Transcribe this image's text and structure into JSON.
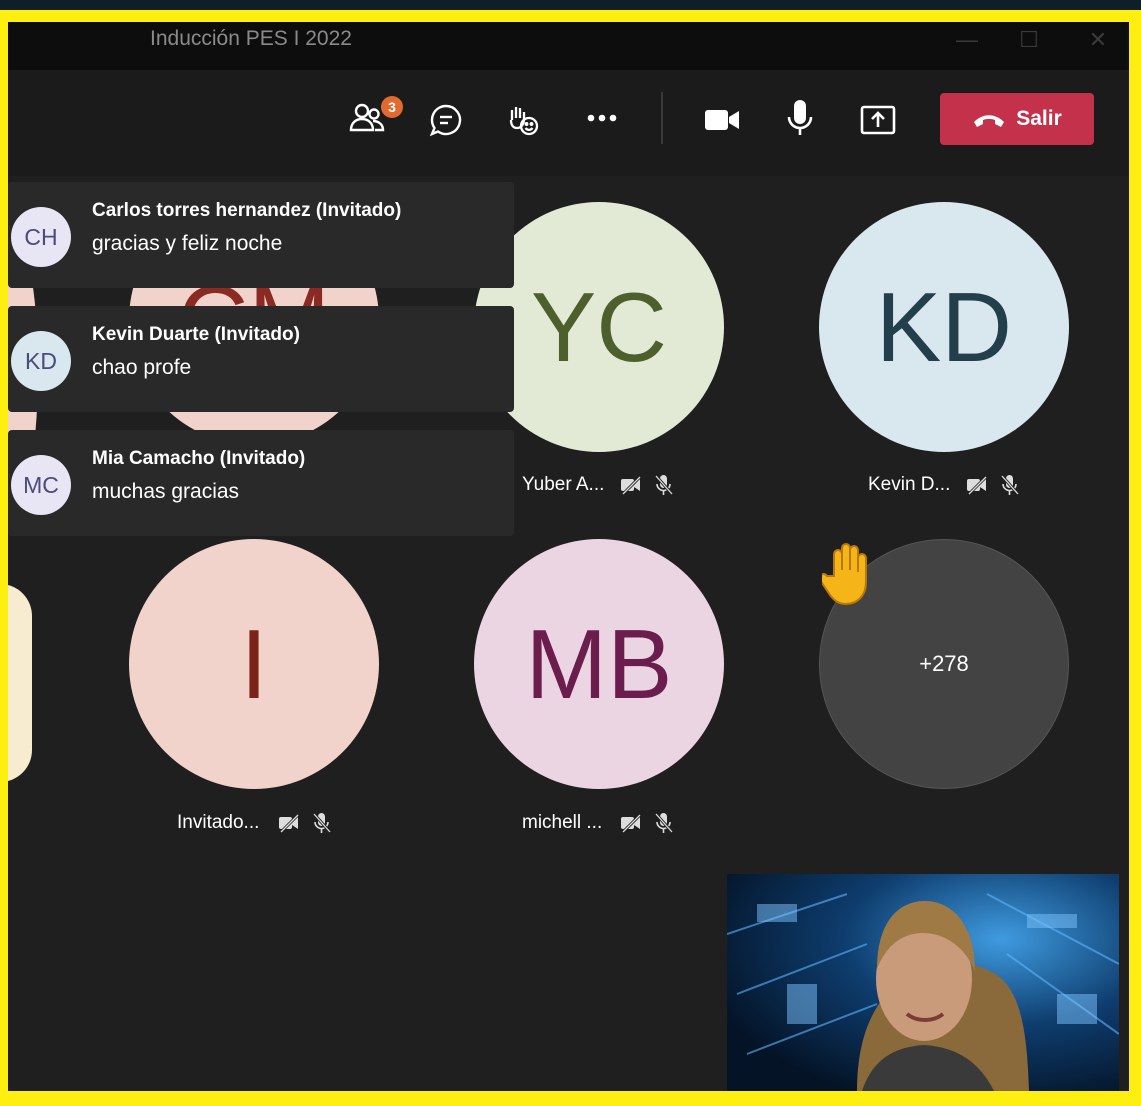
{
  "window": {
    "title": "Inducción PES I 2022"
  },
  "toolbar": {
    "participants_badge": "3",
    "leave_label": "Salir"
  },
  "chat_notifications": [
    {
      "initials": "CH",
      "sender": "Carlos torres hernandez (Invitado)",
      "message": "gracias y feliz noche",
      "avatar_color": "#e8e5f4"
    },
    {
      "initials": "KD",
      "sender": "Kevin Duarte (Invitado)",
      "message": "chao profe",
      "avatar_color": "#d9e7ee"
    },
    {
      "initials": "MC",
      "sender": "Mia Camacho (Invitado)",
      "message": "muchas gracias",
      "avatar_color": "#e8e5f4"
    }
  ],
  "participants": [
    {
      "initials": "CM",
      "name": "",
      "circle_color": "#f2d3cc",
      "text_color": "#8a2a22"
    },
    {
      "initials": "YC",
      "name": "Yuber A...",
      "circle_color": "#e2ead6",
      "text_color": "#4e5f2e"
    },
    {
      "initials": "KD",
      "name": "Kevin D...",
      "circle_color": "#d9e7ee",
      "text_color": "#233f4c"
    },
    {
      "initials": "I",
      "name": "Invitado...",
      "circle_color": "#f2d3cc",
      "text_color": "#7a2418"
    },
    {
      "initials": "MB",
      "name": "michell ...",
      "circle_color": "#ecd5e3",
      "text_color": "#6b1e4d"
    }
  ],
  "overflow": {
    "count_label": "+278",
    "raised_hand": true
  },
  "icons": {
    "people": "people-icon",
    "chat": "chat-icon",
    "react": "raise-hand-react-icon",
    "more": "more-icon",
    "camera": "camera-icon",
    "mic": "microphone-icon",
    "share": "share-icon",
    "phone": "hang-up-icon",
    "video_off": "video-off-icon",
    "mic_off": "mic-off-icon"
  },
  "colors": {
    "leave": "#c4314b",
    "badge": "#e36a2f",
    "background": "#1f1f1f"
  }
}
